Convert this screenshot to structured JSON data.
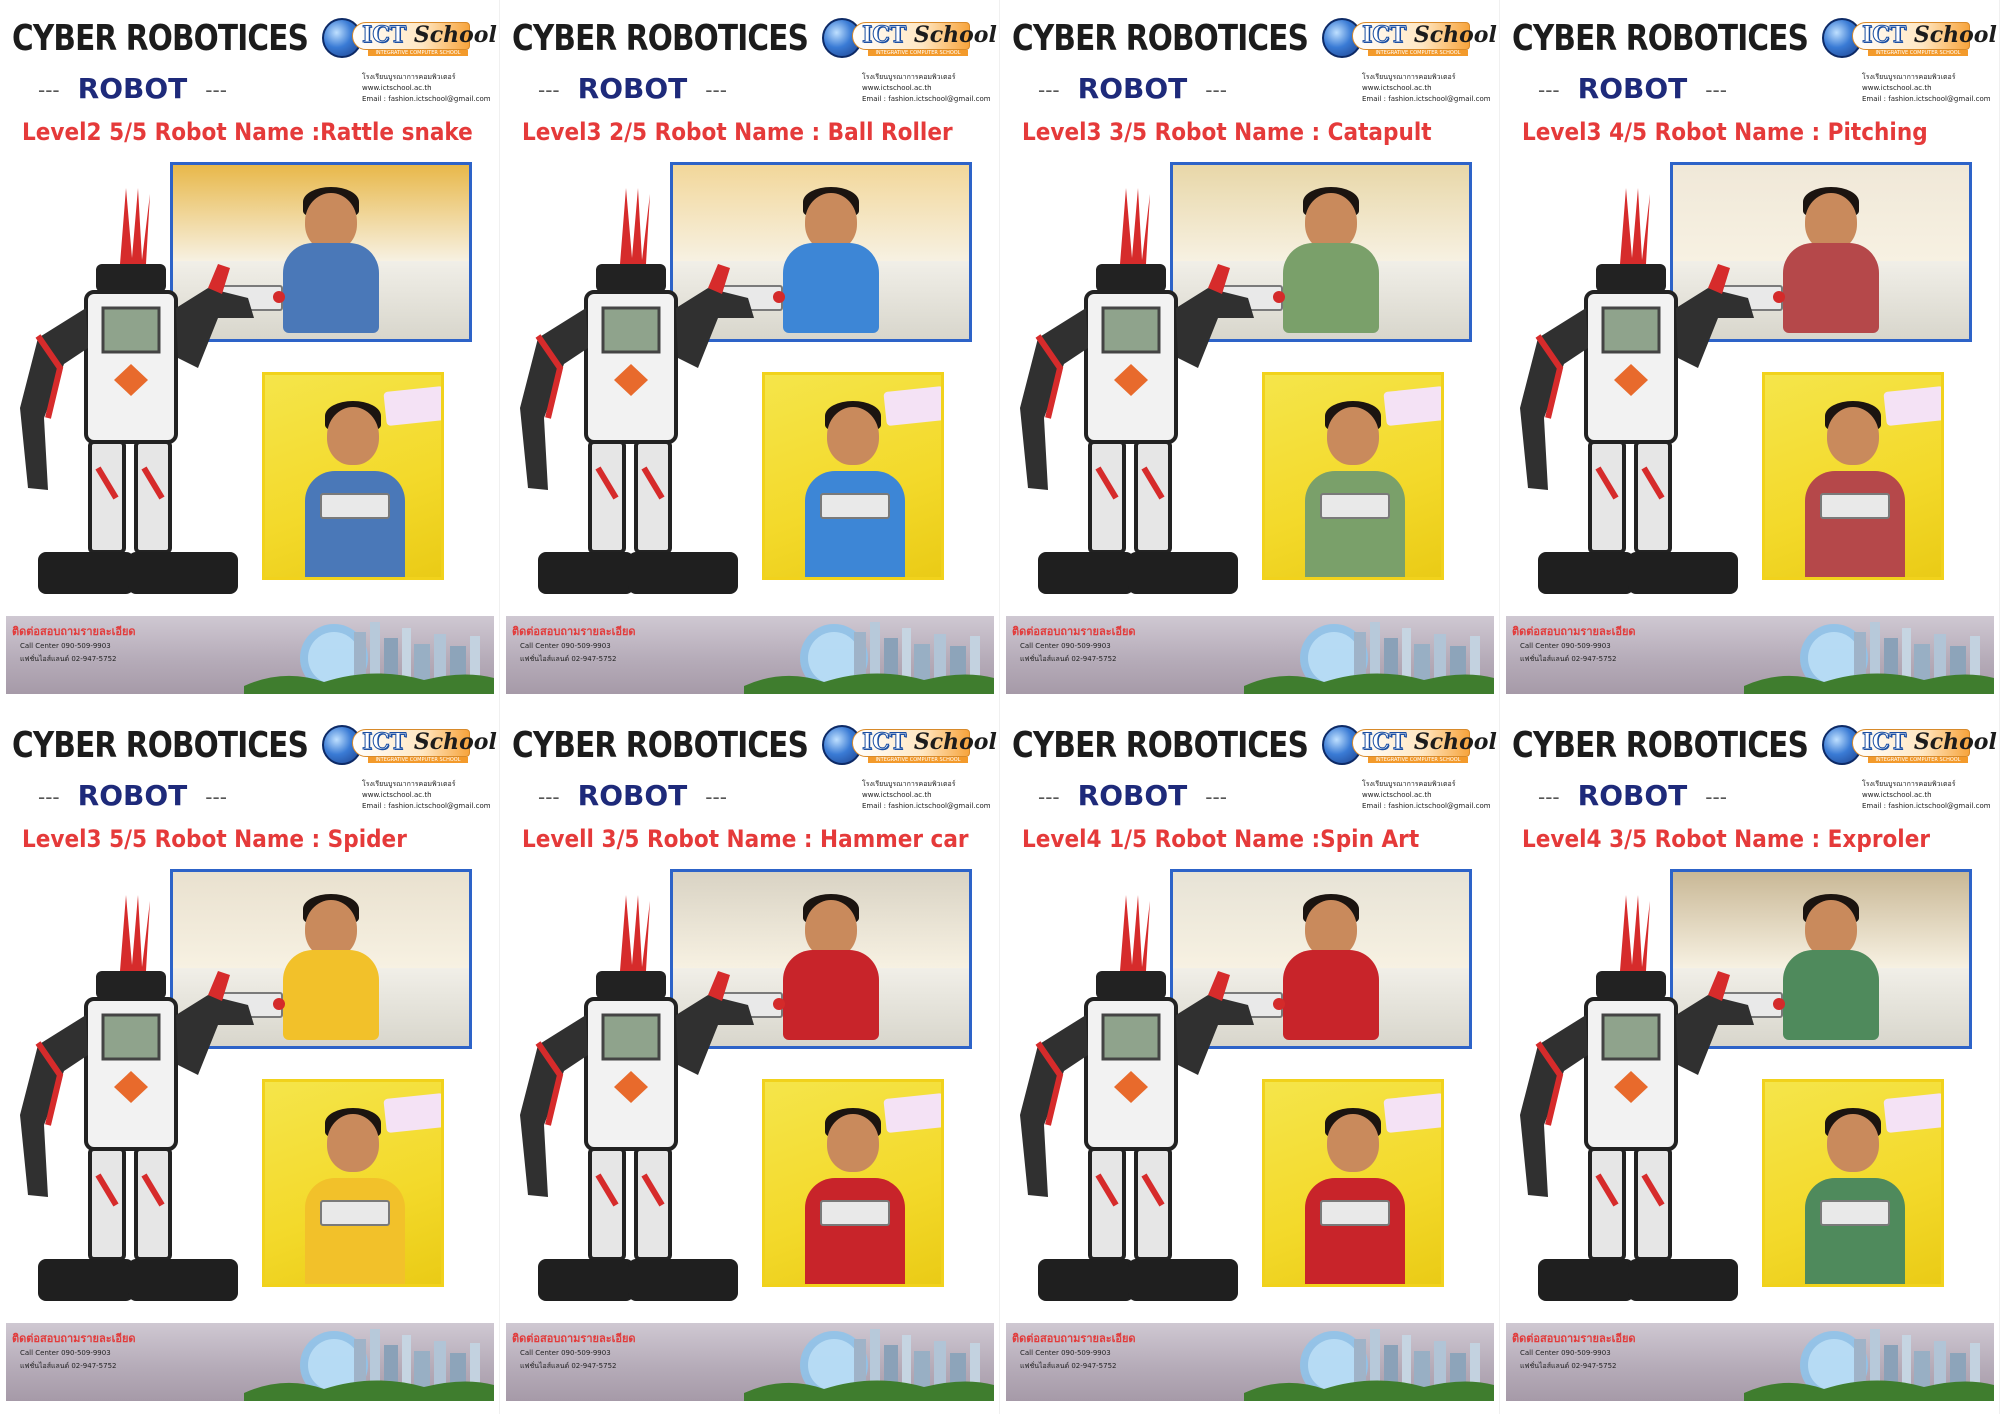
{
  "brand": {
    "title": "CYBER ROBOTICES",
    "logo_ict": "ICT",
    "logo_school": "School",
    "logo_sub": "INTEGRATIVE COMPUTER SCHOOL",
    "robot_label": "ROBOT",
    "dash": "---",
    "contact_line1": "โรงเรียนบูรณาการคอมพิวเตอร์",
    "contact_line2": "www.ictschool.ac.th",
    "contact_line3": "Email : fashion.ictschool@gmail.com",
    "footer_title": "ติดต่อสอบถามรายละเอียด",
    "footer_call": "Call Center  090-509-9903",
    "footer_fashion": "แฟชั่นไอส์แลนด์ 02-947-5752"
  },
  "colors": {
    "level_red": "#e53a3a",
    "robot_navy": "#1e2a7a",
    "photo1_border": "#2d63c8",
    "photo2_border": "#f1d21c"
  },
  "posters": [
    {
      "level": "Level2 5/5 Robot Name :Rattle snake",
      "shirt": "#4a78b8",
      "scene_bg": "#e8b84a"
    },
    {
      "level": "Level3 2/5 Robot Name : Ball Roller",
      "shirt": "#3d86d6",
      "scene_bg": "#f2d79a"
    },
    {
      "level": "Level3 3/5 Robot Name :  Catapult",
      "shirt": "#7aa06a",
      "scene_bg": "#e8d7a8"
    },
    {
      "level": "Level3 4/5 Robot Name : Pitching",
      "shirt": "#b5484a",
      "scene_bg": "#f0e8d8"
    },
    {
      "level": "Level3  5/5 Robot Name : Spider",
      "shirt": "#f2c12a",
      "scene_bg": "#e9e1cf"
    },
    {
      "level": "Levell 3/5 Robot Name : Hammer car",
      "shirt": "#c8242a",
      "scene_bg": "#d9d3c4"
    },
    {
      "level": "Level4 1/5 Robot Name :Spin Art",
      "shirt": "#c8242a",
      "scene_bg": "#e7e3d6"
    },
    {
      "level": "Level4 3/5 Robot Name : Exproler",
      "shirt": "#4f8a5c",
      "scene_bg": "#c9b896"
    }
  ]
}
